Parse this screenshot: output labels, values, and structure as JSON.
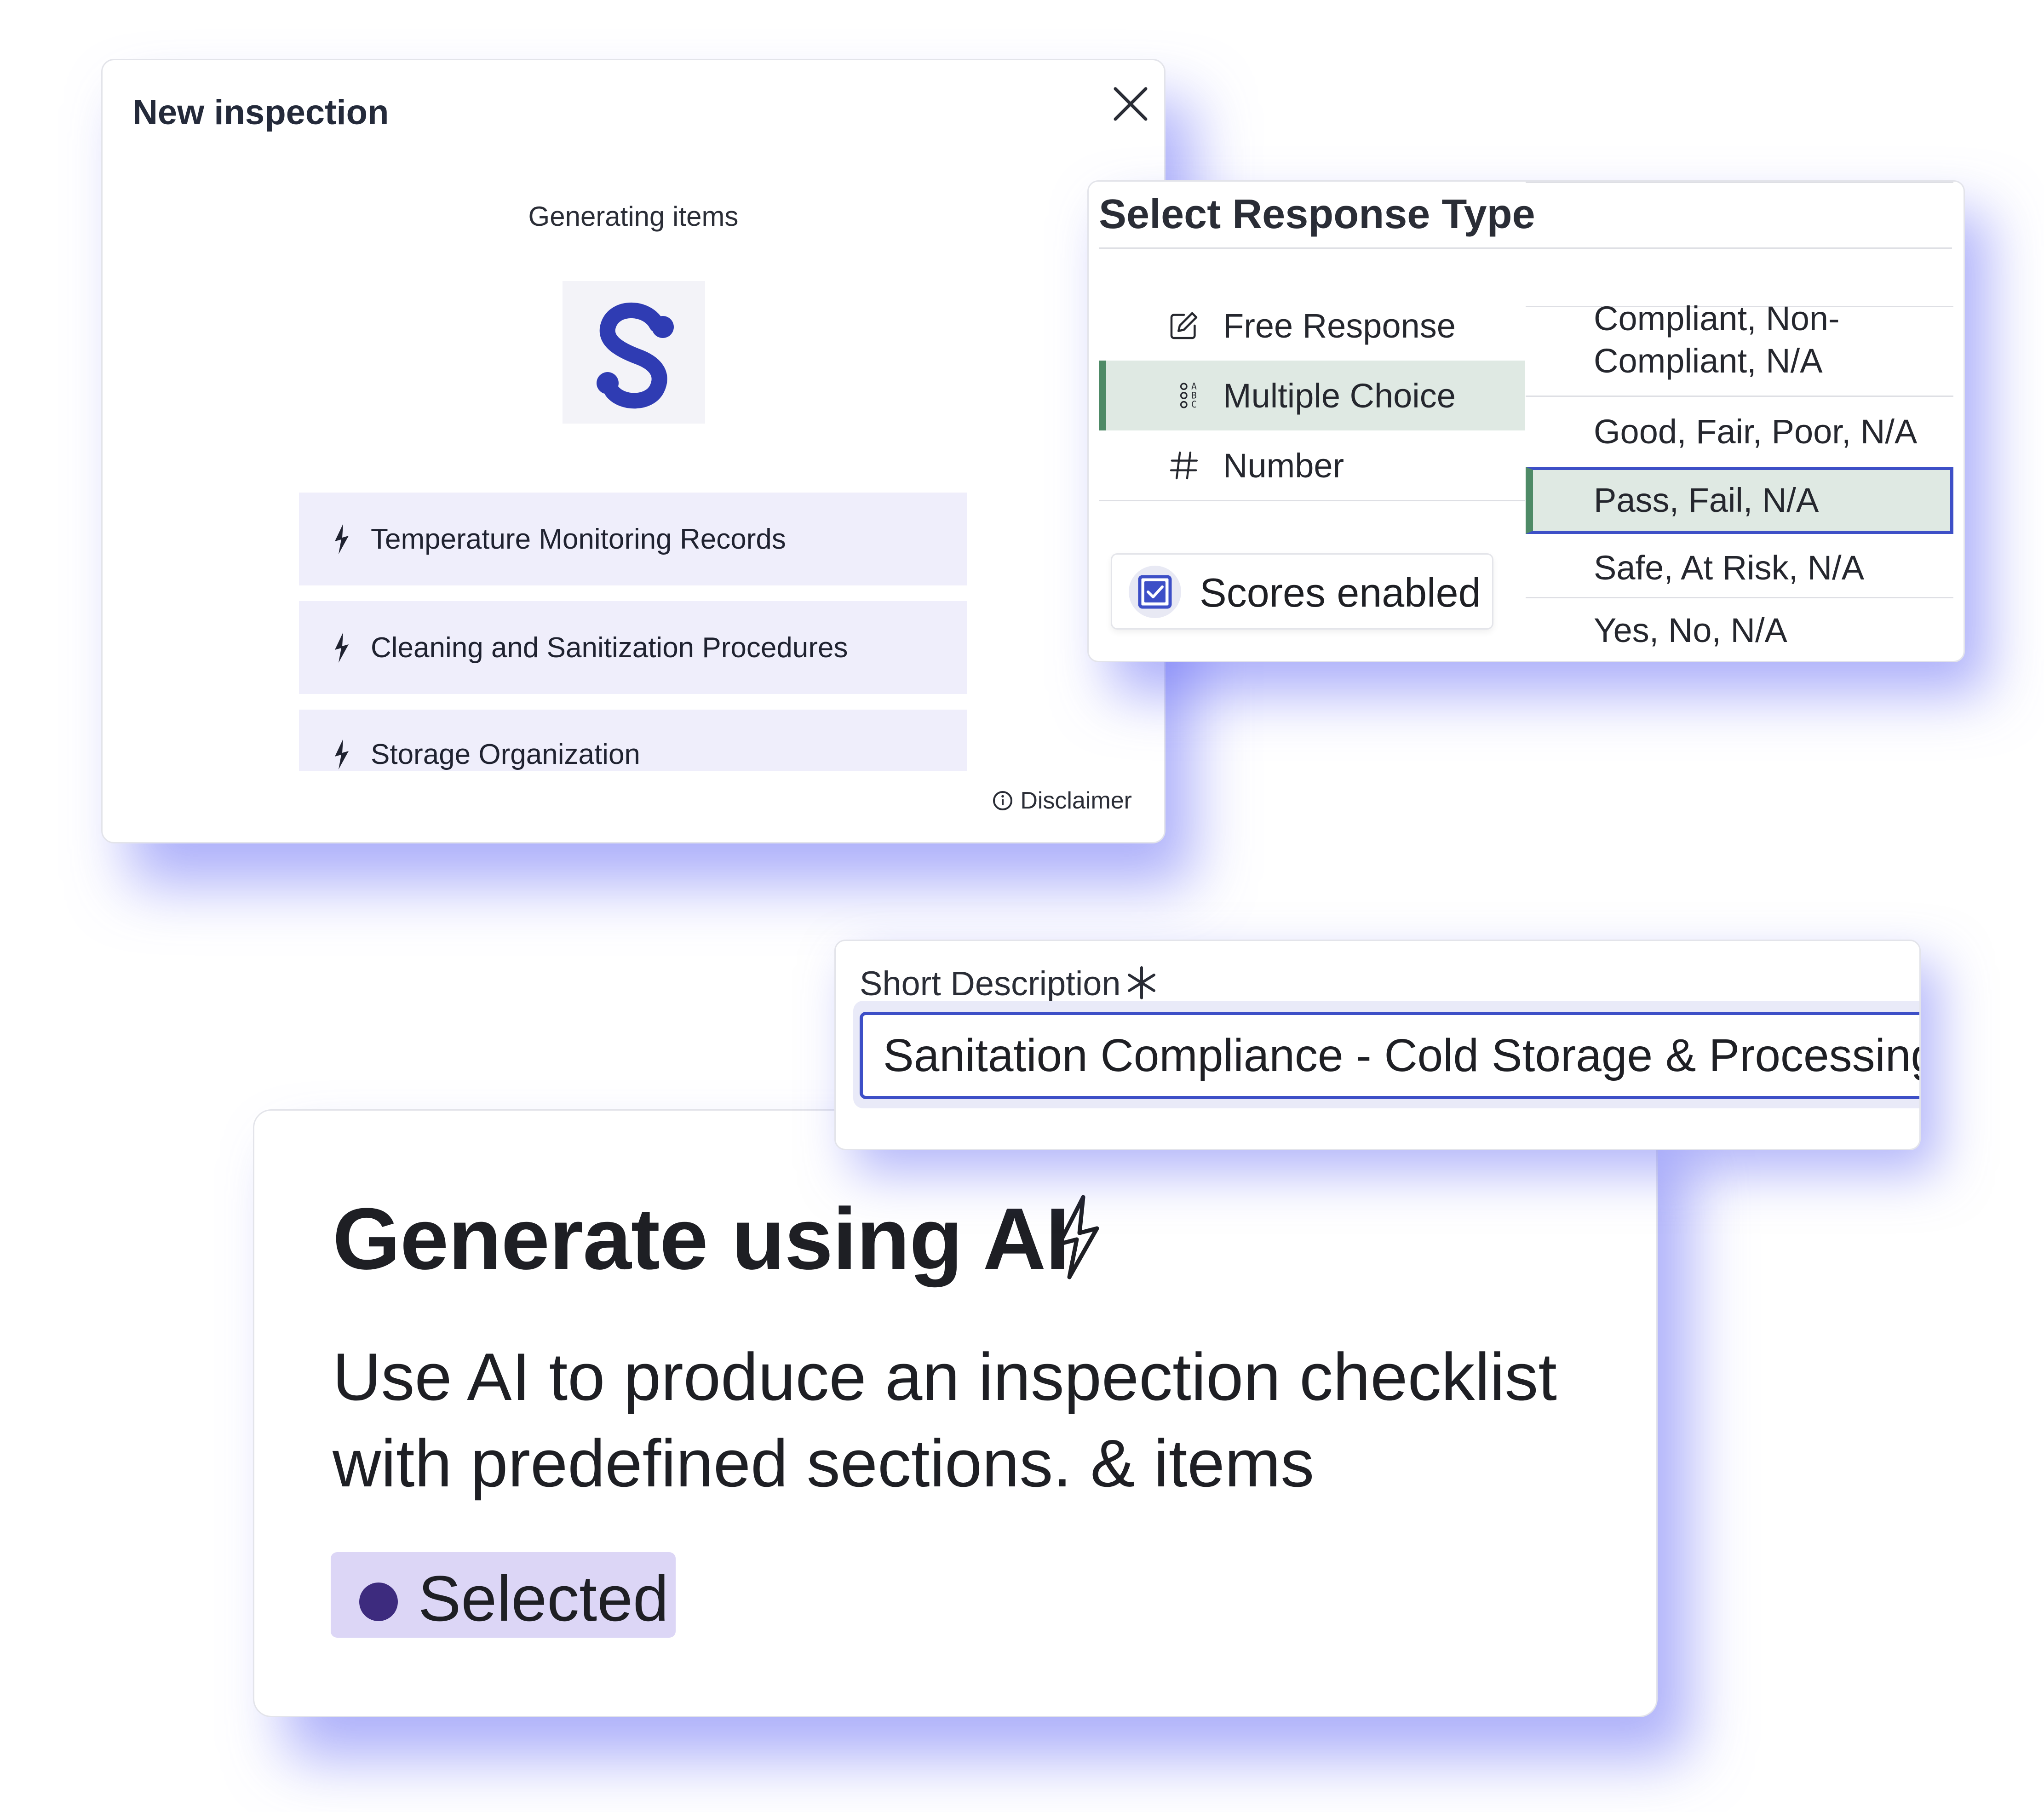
{
  "colors": {
    "accent_blue": "#3d4fc7",
    "selected_green": "#4e8a66",
    "selected_green_bg": "#dfe9e3",
    "item_bg": "#efeefb",
    "badge_bg": "#dcd6f6",
    "badge_dot": "#3d2b7e",
    "glow": "#6970f5",
    "logo": "#2f3cb3"
  },
  "dialog": {
    "title": "New inspection",
    "close_icon": "close-icon",
    "status": "Generating items",
    "logo_icon": "s-logo-icon",
    "items": [
      {
        "icon": "bolt-icon",
        "label": "Temperature Monitoring Records"
      },
      {
        "icon": "bolt-icon",
        "label": "Cleaning and Sanitization Procedures"
      },
      {
        "icon": "bolt-icon",
        "label": "Storage Organization"
      }
    ],
    "disclaimer": {
      "icon": "info-icon",
      "label": "Disclaimer"
    }
  },
  "response_type": {
    "title": "Select Response Type",
    "types": [
      {
        "icon": "pencil-icon",
        "label": "Free Response",
        "selected": false
      },
      {
        "icon": "list-abc-icon",
        "label": "Multiple Choice",
        "selected": true
      },
      {
        "icon": "hash-icon",
        "label": "Number",
        "selected": false
      }
    ],
    "scores": {
      "label": "Scores enabled",
      "checked": true
    },
    "options": [
      {
        "label": "Compliant, Non-\nCompliant, N/A",
        "selected": false
      },
      {
        "label": "Good, Fair, Poor, N/A",
        "selected": false
      },
      {
        "label": "Pass, Fail, N/A",
        "selected": true
      },
      {
        "label": "Safe, At Risk, N/A",
        "selected": false
      },
      {
        "label": "Yes, No, N/A",
        "selected": false
      }
    ]
  },
  "short_description": {
    "label": "Short Description",
    "required_icon": "asterisk-icon",
    "value": "Sanitation Compliance - Cold Storage & Processing"
  },
  "generate_ai": {
    "title": "Generate using AI",
    "title_icon": "bolt-icon",
    "description": "Use AI to produce an inspection checklist with predefined sections. & items",
    "badge": "Selected"
  }
}
